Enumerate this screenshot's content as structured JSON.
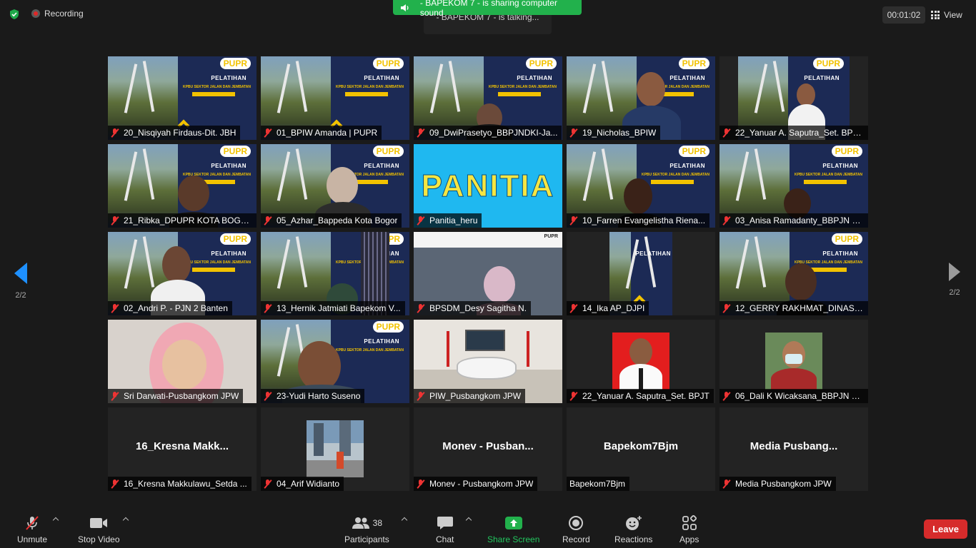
{
  "topbar": {
    "recording_label": "Recording",
    "share_banner": "- BAPEKOM 7 - is sharing computer sound",
    "talking": "- BAPEKOM 7 - is talking...",
    "timer": "00:01:02",
    "view_label": "View"
  },
  "pager": {
    "left": "2/2",
    "right": "2/2"
  },
  "tiles": [
    {
      "name": "20_Nisqiyah Firdaus-Dit. JBH"
    },
    {
      "name": "01_BPIW Amanda | PUPR"
    },
    {
      "name": "09_DwiPrasetyo_BBPJNDKI-Ja..."
    },
    {
      "name": "19_Nicholas_BPIW"
    },
    {
      "name": "22_Yanuar A. Saputra_Set. BPJ..."
    },
    {
      "name": "21_Ribka_DPUPR KOTA BOGOR"
    },
    {
      "name": "05_Azhar_Bappeda Kota Bogor"
    },
    {
      "name": "Panitia_heru",
      "big": "PANITIA"
    },
    {
      "name": "10_Farren Evangelistha Riena..."
    },
    {
      "name": "03_Anisa Ramadanty_BBPJN D..."
    },
    {
      "name": "02_Andri P. - PJN 2 Banten"
    },
    {
      "name": "13_Hernik Jatmiati Bapekom V..."
    },
    {
      "name": "BPSDM_Desy Sagitha N."
    },
    {
      "name": "14_Ika AP_DJPI"
    },
    {
      "name": "12_GERRY RAKHMAT_DINAS P..."
    },
    {
      "name": "Sri Darwati-Pusbangkom JPW"
    },
    {
      "name": "23-Yudi Harto Suseno"
    },
    {
      "name": "PIW_Pusbangkom JPW"
    },
    {
      "name": "22_Yanuar A. Saputra_Set. BPJT"
    },
    {
      "name": "06_Dali K Wicaksana_BBPJN S..."
    },
    {
      "name": "16_Kresna Makkulawu_Setda ...",
      "big": "16_Kresna  Makk..."
    },
    {
      "name": "04_Arif Widianto"
    },
    {
      "name": "Monev - Pusbangkom JPW",
      "big": "Monev  -  Pusban..."
    },
    {
      "name": "Bapekom7Bjm",
      "big": "Bapekom7Bjm"
    },
    {
      "name": "Media Pusbangkom JPW",
      "big": "Media  Pusbang..."
    }
  ],
  "slide": {
    "logo": "PUPR",
    "title": "PELATIHAN",
    "subtitle": "KPBU SEKTOR JALAN DAN JEMBATAN"
  },
  "toolbar": {
    "unmute": "Unmute",
    "stop_video": "Stop Video",
    "participants": "Participants",
    "participants_count": "38",
    "chat": "Chat",
    "share_screen": "Share Screen",
    "record": "Record",
    "reactions": "Reactions",
    "apps": "Apps",
    "leave": "Leave"
  },
  "colors": {
    "accent_blue": "#1e90ff",
    "share_green": "#22b14c",
    "leave_red": "#d62b2b",
    "mute_red": "#e33333"
  }
}
